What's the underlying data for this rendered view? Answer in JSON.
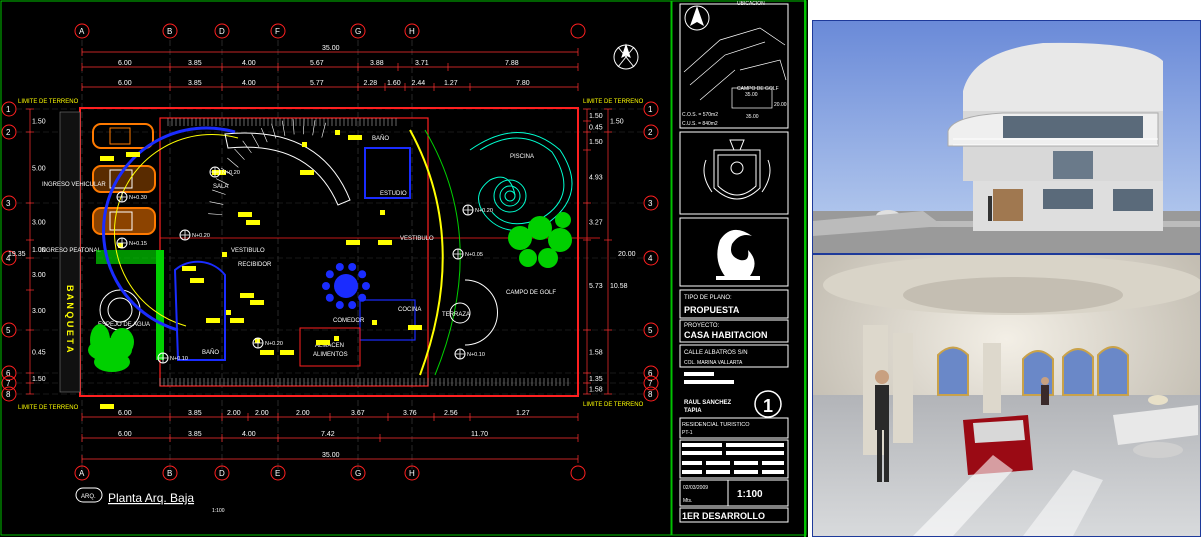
{
  "plan": {
    "title": "Planta Arq. Baja",
    "scale_note": "1:100",
    "title_badge": "ARQ.",
    "col_labels_top": [
      "A",
      "B",
      "D",
      "F",
      "G",
      "H"
    ],
    "col_labels_bottom": [
      "A",
      "B",
      "D",
      "E",
      "G",
      "H"
    ],
    "row_labels_left": [
      "1",
      "2",
      "3",
      "4",
      "5",
      "6",
      "7",
      "8"
    ],
    "row_labels_right": [
      "1",
      "2",
      "3",
      "4",
      "5",
      "6",
      "7",
      "8"
    ],
    "overall_width": "35.00",
    "dims_top_row1": [
      "6.00",
      "3.85",
      "4.00",
      "5.67",
      "3.88",
      "3.71",
      "7.88"
    ],
    "dims_top_row2": [
      "6.00",
      "3.85",
      "4.00",
      "5.77",
      "2.28",
      "1.60",
      "2.44",
      "1.27",
      "7.80"
    ],
    "dims_bottom_row1": [
      "6.00",
      "3.85",
      "2.00",
      "2.00",
      "2.00",
      "3.67",
      "3.76",
      "2.56",
      "1.27",
      "7.80"
    ],
    "dims_bottom_row2": [
      "6.00",
      "3.85",
      "4.00",
      "7.42",
      "11.70"
    ],
    "dims_left": [
      "1.50",
      "5.00",
      "3.00",
      "1.00",
      "3.00",
      "3.00",
      "0.45",
      "1.50",
      "19.35"
    ],
    "dims_right": [
      "1.50",
      "0.45",
      "1.50",
      "4.93",
      "3.27",
      "10.58",
      "5.73",
      "1.58",
      "1.35",
      "1.58",
      "1.50",
      "20.00"
    ],
    "limit_label": "LIMITE DE TERRENO",
    "rooms": {
      "sala": "SALA",
      "estudio": "ESTUDIO",
      "bano_top": "BAÑO",
      "vestibulo_right": "VESTIBULO",
      "vestibulo_left": "VESTIBULO",
      "recibidor": "RECIBIDOR",
      "comedor": "COMEDOR",
      "cocina": "COCINA",
      "almacen": "ALMACEN",
      "alimentos": "ALIMENTOS",
      "bano_bottom": "BAÑO",
      "terraza": "TERRAZA",
      "piscina": "PISCINA",
      "campo_golf": "CAMPO DE GOLF",
      "espejo_agua": "ESPEJO DE AGUA",
      "ingreso_vehicular": "INGRESO VEHICULAR",
      "ingreso_peatonal": "INGRESO PEATONAL",
      "banqueta": "B A N Q U E T A"
    },
    "levels": [
      "N+0.20",
      "N+0.30",
      "N+0.15",
      "N+0.20",
      "N+0.10",
      "N+0.20",
      "N+0.20",
      "N+0.05",
      "N+0.10"
    ]
  },
  "title_block": {
    "ubicacion": "UBICACION",
    "cos": "C.O.S. = 570m2",
    "cus": "C.U.S. = 840m2",
    "campo_golf": "CAMPO DE GOLF",
    "dim_a": "35.00",
    "dim_b": "20.00",
    "dim_c": "35.00",
    "tipo_label": "TIPO DE PLANO:",
    "tipo_value": "PROPUESTA",
    "proyecto_label": "PROYECTO:",
    "proyecto_value": "CASA HABITACION",
    "address1": "CALLE ALBATROS S/N",
    "address2": "COL. MARINA VALLARTA",
    "author1": "RAUL SANCHEZ",
    "author2": "TAPIA",
    "sheet_number": "1",
    "project_type": "RESIDENCIAL TURISTICO",
    "sheet_code": "PT-1",
    "date": "02/03/2009",
    "units": "Mts.",
    "scale": "1:100",
    "phase": "1ER DESARROLLO"
  },
  "colors": {
    "cad_bg": "#000000",
    "wall": "#ff2020",
    "dim": "#ff3030",
    "text_white": "#ffffff",
    "yellow": "#ffff00",
    "blue": "#1a2cff",
    "green": "#00d000",
    "cyan": "#00ffd0",
    "orange": "#ff7a00",
    "frame": "#00c000"
  }
}
